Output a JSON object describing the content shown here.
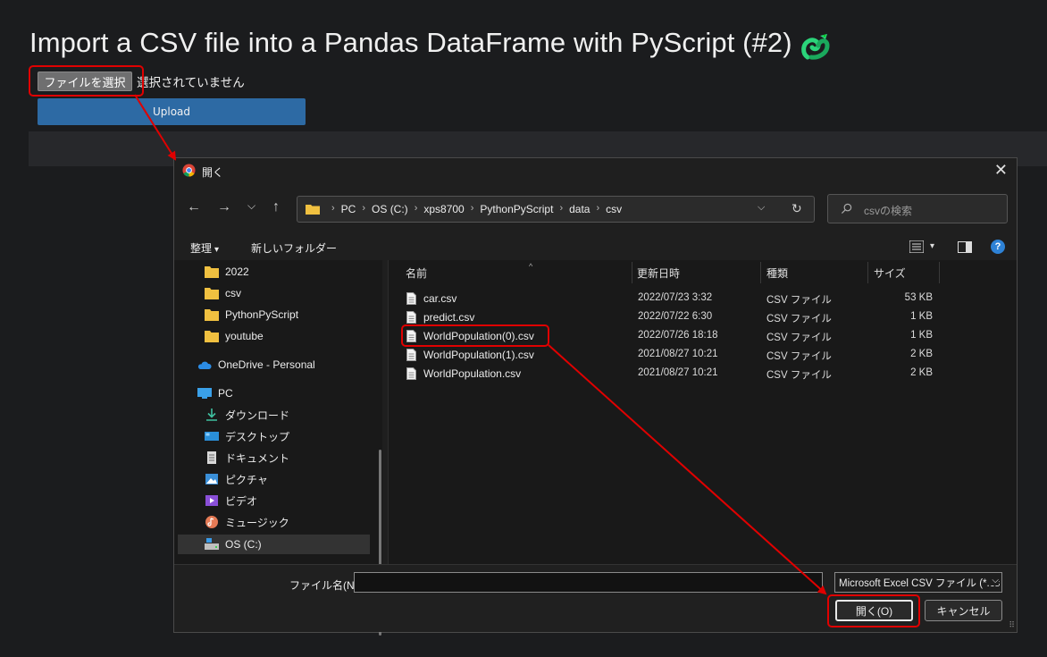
{
  "page": {
    "title": "Import a CSV file into a Pandas DataFrame with PyScript (#2)",
    "file_button_label": "ファイルを選択",
    "file_status": "選択されていません",
    "upload_label": "Upload"
  },
  "dialog": {
    "title": "開く",
    "close_glyph": "✕",
    "nav": {
      "back": "←",
      "forward": "→",
      "recent": "⌵",
      "up": "↑"
    },
    "breadcrumbs": [
      "PC",
      "OS (C:)",
      "xps8700",
      "PythonPyScript",
      "data",
      "csv"
    ],
    "breadcrumb_sep": "›",
    "address_dropdown_glyph": "⌵",
    "refresh_glyph": "↻",
    "search_placeholder": "csvの検索",
    "toolbar": {
      "organize": "整理",
      "new_folder": "新しいフォルダー",
      "caret": "▾",
      "help": "?"
    },
    "sidebar": {
      "folders": [
        "2022",
        "csv",
        "PythonPyScript",
        "youtube"
      ],
      "onedrive": "OneDrive - Personal",
      "pc": "PC",
      "pc_items": [
        {
          "label": "ダウンロード",
          "icon": "download-icon"
        },
        {
          "label": "デスクトップ",
          "icon": "desktop-icon"
        },
        {
          "label": "ドキュメント",
          "icon": "documents-icon"
        },
        {
          "label": "ピクチャ",
          "icon": "pictures-icon"
        },
        {
          "label": "ビデオ",
          "icon": "videos-icon"
        },
        {
          "label": "ミュージック",
          "icon": "music-icon"
        },
        {
          "label": "OS (C:)",
          "icon": "drive-icon"
        }
      ]
    },
    "columns": {
      "name": "名前",
      "modified": "更新日時",
      "type": "種類",
      "size": "サイズ"
    },
    "sort_glyph": "^",
    "files": [
      {
        "name": "car.csv",
        "modified": "2022/07/23 3:32",
        "type": "CSV ファイル",
        "size": "53 KB"
      },
      {
        "name": "predict.csv",
        "modified": "2022/07/22 6:30",
        "type": "CSV ファイル",
        "size": "1 KB"
      },
      {
        "name": "WorldPopulation(0).csv",
        "modified": "2022/07/26 18:18",
        "type": "CSV ファイル",
        "size": "1 KB"
      },
      {
        "name": "WorldPopulation(1).csv",
        "modified": "2021/08/27 10:21",
        "type": "CSV ファイル",
        "size": "2 KB"
      },
      {
        "name": "WorldPopulation.csv",
        "modified": "2021/08/27 10:21",
        "type": "CSV ファイル",
        "size": "2 KB"
      }
    ],
    "filename_label": "ファイル名(N):",
    "filename_value": "",
    "filter_value": "Microsoft Excel CSV ファイル (*.cs",
    "filter_caret": "⌵",
    "open_button": "開く(O)",
    "cancel_button": "キャンセル",
    "grip": "⠿"
  },
  "colors": {
    "background": "#1b1c1e",
    "upload": "#2d6aa4",
    "highlight": "#e00000",
    "folder": "#f0c040",
    "help": "#2e82d6"
  }
}
